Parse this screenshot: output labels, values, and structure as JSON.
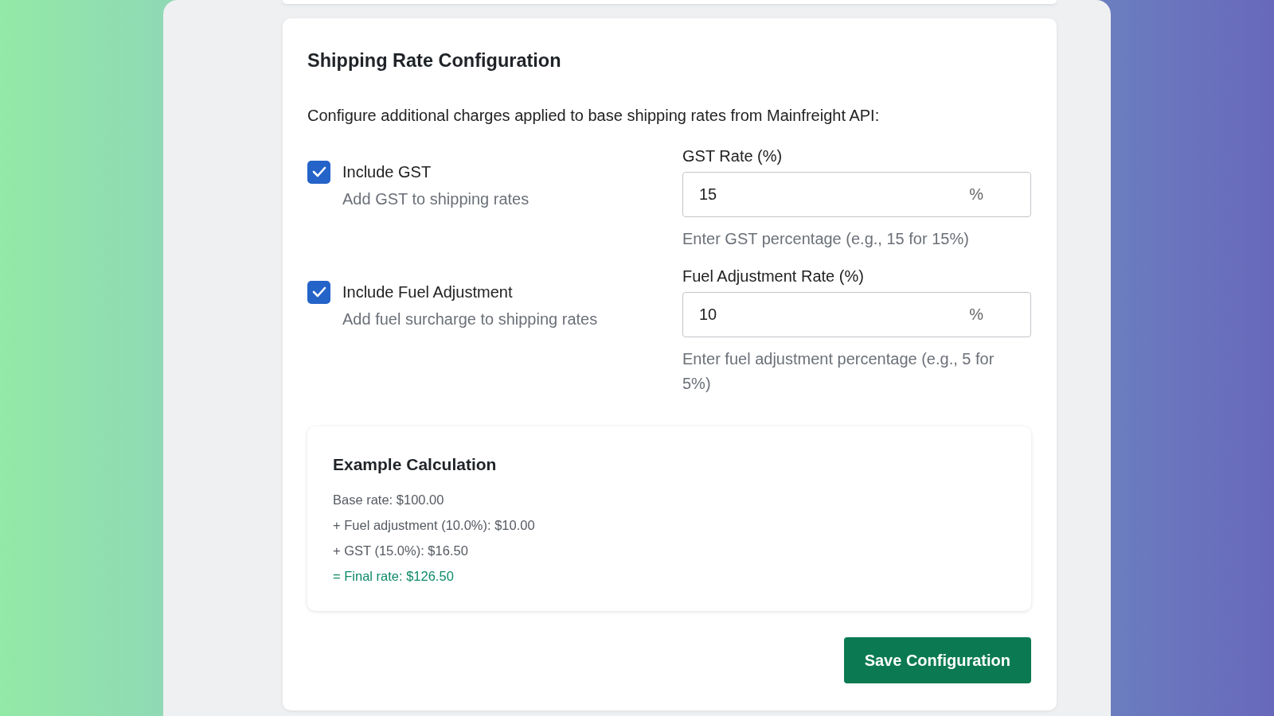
{
  "card": {
    "title": "Shipping Rate Configuration",
    "description": "Configure additional charges applied to base shipping rates from Mainfreight API:",
    "charges": [
      {
        "label": "Include GST",
        "checked": true,
        "hint": "Add GST to shipping rates",
        "field_label": "GST Rate (%)",
        "value": "15",
        "suffix": "%",
        "help": "Enter GST percentage (e.g., 15 for 15%)"
      },
      {
        "label": "Include Fuel Adjustment",
        "checked": true,
        "hint": "Add fuel surcharge to shipping rates",
        "field_label": "Fuel Adjustment Rate (%)",
        "value": "10",
        "suffix": "%",
        "help": "Enter fuel adjustment percentage (e.g., 5 for 5%)"
      }
    ],
    "example": {
      "title": "Example Calculation",
      "lines": [
        {
          "kind": "step",
          "text": "Base rate: $100.00"
        },
        {
          "kind": "step",
          "text": "+ Fuel adjustment (10.0%): $10.00"
        },
        {
          "kind": "step",
          "text": "+ GST (15.0%): $16.50"
        },
        {
          "kind": "total",
          "text": "= Final rate: $126.50"
        }
      ]
    },
    "save_button": "Save Configuration"
  }
}
